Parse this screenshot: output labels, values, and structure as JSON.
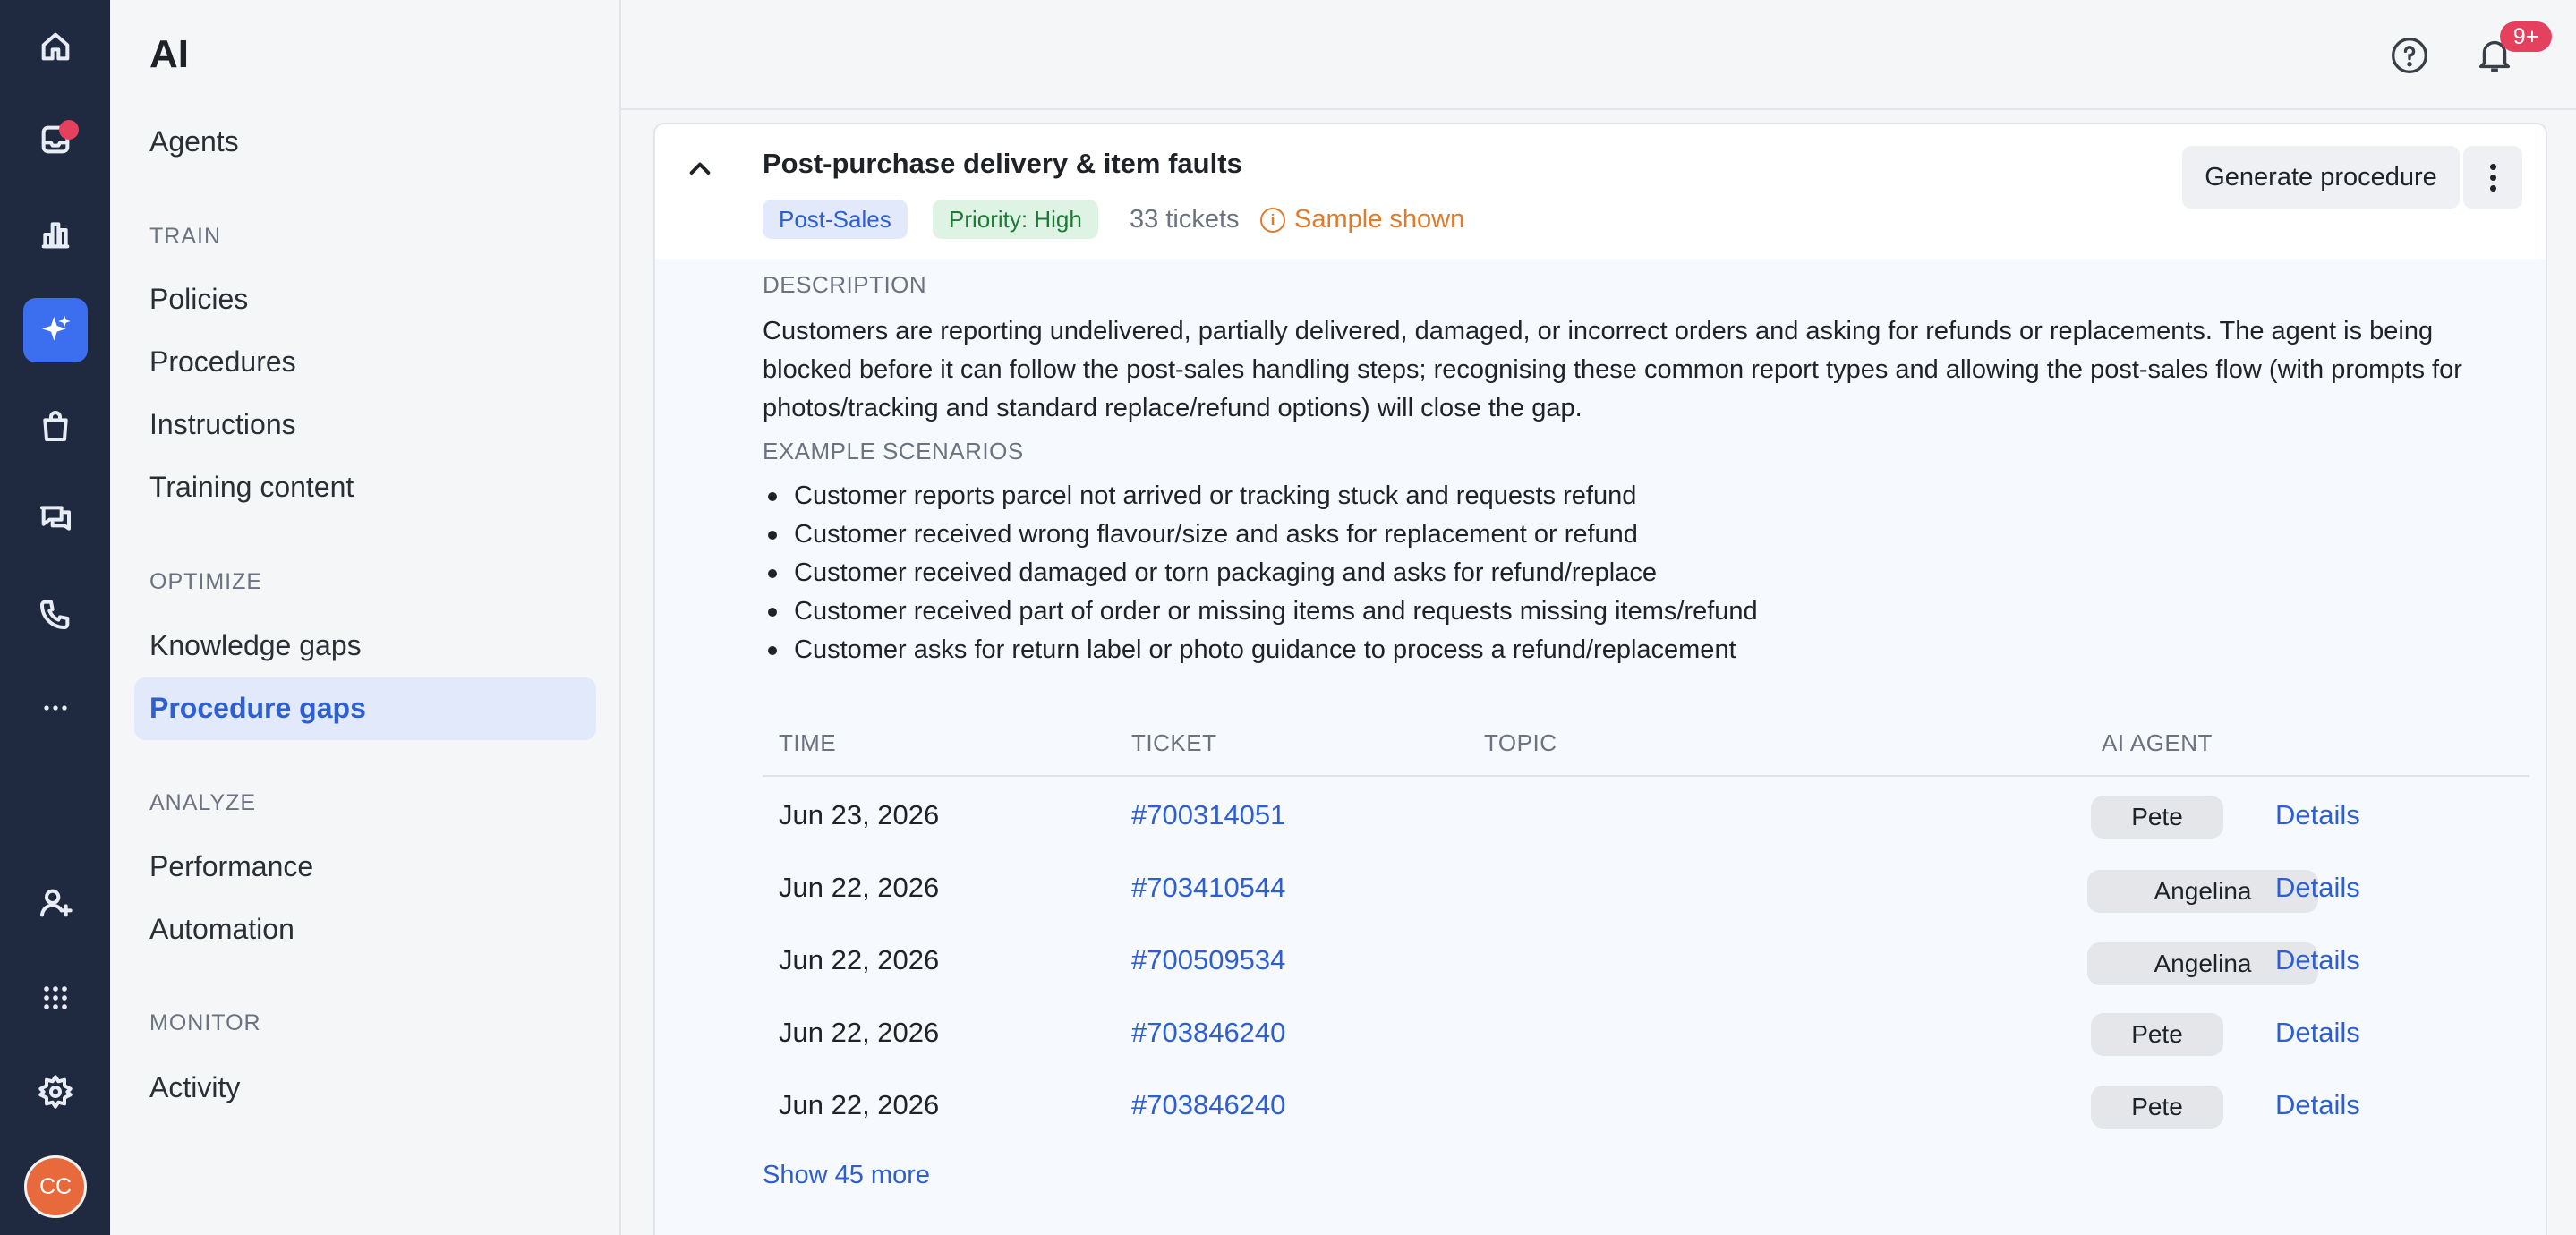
{
  "rail": {
    "avatar_initials": "CC",
    "icons": [
      "home-icon",
      "inbox-icon",
      "analytics-icon",
      "ai-sparkle-icon",
      "shopping-bag-icon",
      "chat-icon",
      "phone-icon",
      "more-icon",
      "add-user-icon",
      "apps-grid-icon",
      "settings-icon"
    ]
  },
  "sidebar": {
    "title": "AI",
    "agents": "Agents",
    "train_header": "TRAIN",
    "train_items": [
      "Policies",
      "Procedures",
      "Instructions",
      "Training content"
    ],
    "optimize_header": "OPTIMIZE",
    "optimize_items": [
      "Knowledge gaps",
      "Procedure gaps"
    ],
    "analyze_header": "ANALYZE",
    "analyze_items": [
      "Performance",
      "Automation"
    ],
    "monitor_header": "MONITOR",
    "monitor_items": [
      "Activity"
    ],
    "active_item": "Procedure gaps"
  },
  "topbar": {
    "notification_badge": "9+"
  },
  "card": {
    "title": "Post-purchase delivery & item faults",
    "category_tag": "Post-Sales",
    "priority_tag": "Priority: High",
    "ticket_count": "33 tickets",
    "sample_note": "Sample shown",
    "generate_button": "Generate procedure",
    "description_label": "DESCRIPTION",
    "description": "Customers are reporting undelivered, partially delivered, damaged, or incorrect orders and asking for refunds or replacements. The agent is being blocked before it can follow the post-sales handling steps; recognising these common report types and allowing the post-sales flow (with prompts for photos/tracking and standard replace/refund options) will close the gap.",
    "scenarios_label": "EXAMPLE SCENARIOS",
    "scenarios": [
      "Customer reports parcel not arrived or tracking stuck and requests refund",
      "Customer received wrong flavour/size and asks for replacement or refund",
      "Customer received damaged or torn packaging and asks for refund/replace",
      "Customer received part of order or missing items and requests missing items/refund",
      "Customer asks for return label or photo guidance to process a refund/replacement"
    ],
    "table": {
      "headers": [
        "TIME",
        "TICKET",
        "TOPIC",
        "AI AGENT"
      ],
      "rows": [
        {
          "time": "Jun 23, 2026",
          "ticket": "#700314051",
          "topic": "",
          "agent": "Pete",
          "action": "Details"
        },
        {
          "time": "Jun 22, 2026",
          "ticket": "#703410544",
          "topic": "",
          "agent": "Angelina",
          "action": "Details"
        },
        {
          "time": "Jun 22, 2026",
          "ticket": "#700509534",
          "topic": "",
          "agent": "Angelina",
          "action": "Details"
        },
        {
          "time": "Jun 22, 2026",
          "ticket": "#703846240",
          "topic": "",
          "agent": "Pete",
          "action": "Details"
        },
        {
          "time": "Jun 22, 2026",
          "ticket": "#703846240",
          "topic": "",
          "agent": "Pete",
          "action": "Details"
        }
      ]
    },
    "show_more": "Show 45 more"
  },
  "colors": {
    "rail_bg": "#1f2a40",
    "accent": "#3b6ff0",
    "link": "#2e5fd0",
    "warning": "#e07b2b",
    "badge": "#e5405e"
  }
}
